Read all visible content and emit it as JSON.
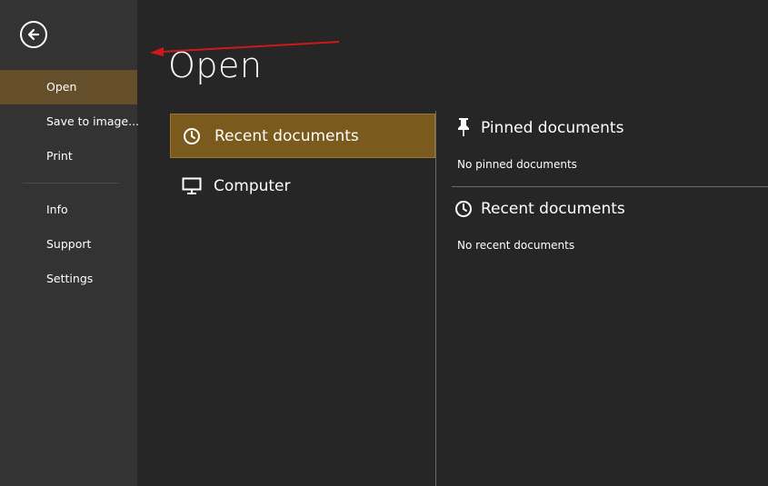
{
  "sidebar": {
    "back_icon": "arrow-left-circle-icon",
    "items": [
      {
        "label": "Open"
      },
      {
        "label": "Save to image..."
      },
      {
        "label": "Print"
      },
      {
        "label": "Info"
      },
      {
        "label": "Support"
      },
      {
        "label": "Settings"
      }
    ]
  },
  "main": {
    "title": "Open",
    "sources": [
      {
        "label": "Recent documents",
        "icon": "clock-icon"
      },
      {
        "label": "Computer",
        "icon": "monitor-icon"
      }
    ],
    "pinned": {
      "title": "Pinned documents",
      "icon": "pin-icon",
      "empty_text": "No pinned documents"
    },
    "recent": {
      "title": "Recent documents",
      "icon": "clock-icon",
      "empty_text": "No recent documents"
    }
  },
  "colors": {
    "background": "#262626",
    "sidebar": "#333333",
    "sidebar_active": "#654f2b",
    "accent": "#7a5a1d",
    "annotation": "#d0181c"
  }
}
